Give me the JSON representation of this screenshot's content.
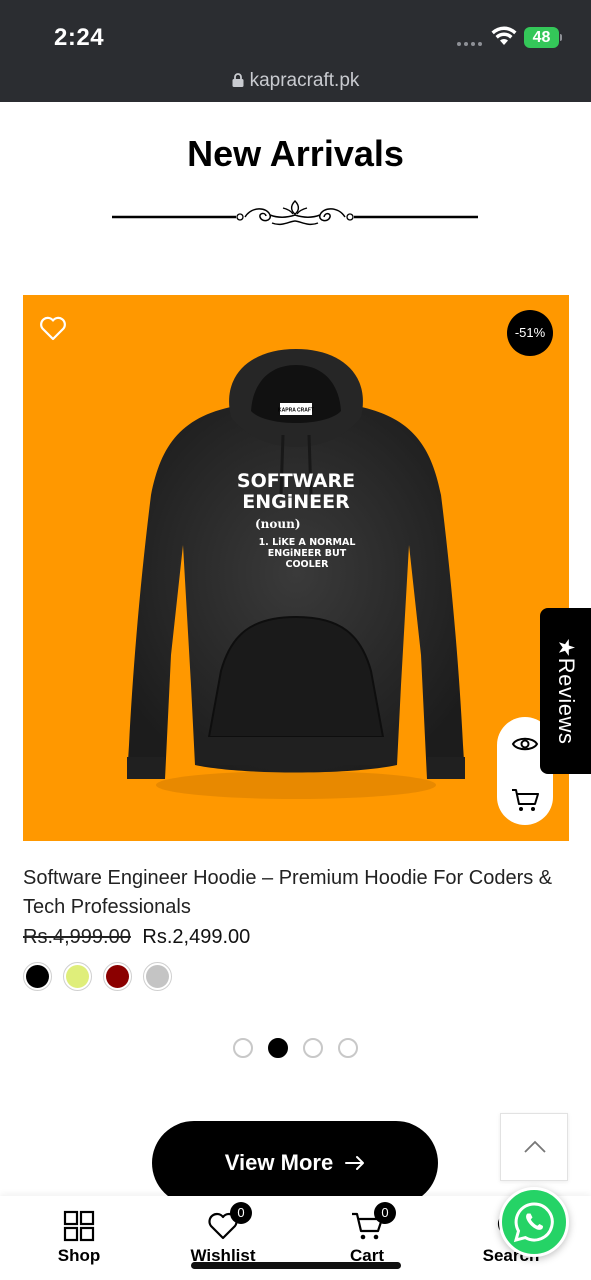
{
  "status_bar": {
    "time": "2:24",
    "battery": "48",
    "url": "kapracraft.pk"
  },
  "section": {
    "title": "New Arrivals"
  },
  "product": {
    "discount": "-51%",
    "hoodie_print": {
      "brand_tag": "KAPRA CRAFT",
      "line1": "SOFTWARE",
      "line2": "ENGiNEER",
      "line3": "(noun)",
      "line4": "1. LiKE A NORMAL",
      "line5": "ENGiNEER BUT",
      "line6": "COOLER"
    },
    "title": "Software Engineer Hoodie – Premium Hoodie For Coders & Tech Professionals",
    "price_old": "Rs.4,999.00",
    "price_new": "Rs.2,499.00",
    "colors": [
      "#000000",
      "#dfee7a",
      "#8b0000",
      "#c4c4c4"
    ]
  },
  "reviews_tab": {
    "label": "★Reviews"
  },
  "pagination": {
    "total": 4,
    "active": 2
  },
  "view_more": {
    "label": "View More"
  },
  "bottom_nav": {
    "shop": "Shop",
    "wishlist": "Wishlist",
    "wishlist_count": "0",
    "cart": "Cart",
    "cart_count": "0",
    "search": "Search"
  },
  "colors": {
    "brand_orange": "#ff9800",
    "whatsapp_green": "#25d366",
    "status_bar_bg": "#2b2d31"
  },
  "icons": [
    "lock-icon",
    "wifi-icon",
    "heart-icon",
    "eye-icon",
    "cart-icon",
    "chevron-up-icon",
    "grid-icon",
    "search-icon",
    "whatsapp-icon",
    "arrow-right-icon"
  ]
}
